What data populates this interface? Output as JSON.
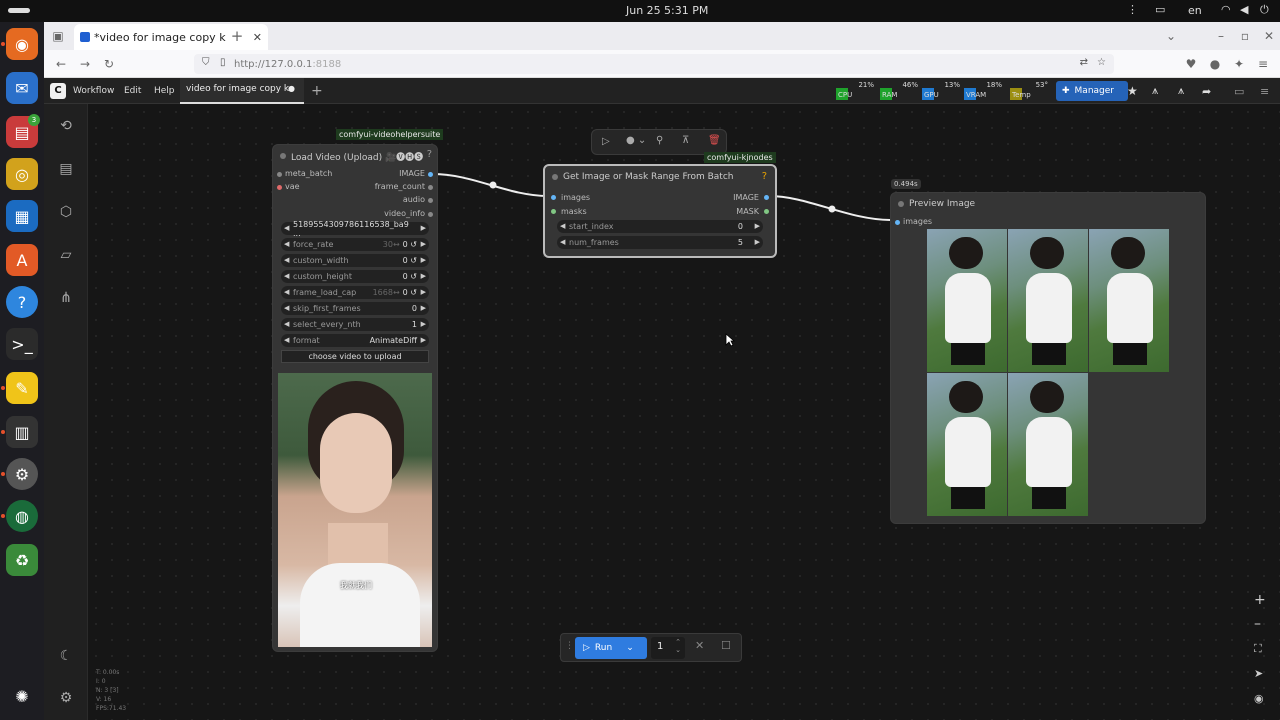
{
  "os": {
    "date": "Jun 25",
    "time": "5:31 PM",
    "lang": "en",
    "badge_count": "3"
  },
  "browser": {
    "tab_title": "*video for image copy k",
    "url_host": "http://127.0.0.1",
    "url_port": ":8188"
  },
  "menu": {
    "workflow": "Workflow",
    "edit": "Edit",
    "help": "Help",
    "tab": "video for image copy k",
    "manager": "Manager"
  },
  "stats": [
    {
      "name": "CPU",
      "pct": "21%",
      "color": "#1fa32c"
    },
    {
      "name": "RAM",
      "pct": "46%",
      "color": "#1fa32c"
    },
    {
      "name": "GPU",
      "pct": "13%",
      "color": "#1f7ad1"
    },
    {
      "name": "VRAM",
      "pct": "18%",
      "color": "#1f7ad1"
    },
    {
      "name": "Temp",
      "pct": "53°",
      "color": "#9c8f12"
    }
  ],
  "nodes": {
    "load_video": {
      "package": "comfyui-videohelpersuite",
      "title": "Load Video (Upload) 🎥🅥🅗🅢",
      "inputs": [
        "meta_batch",
        "vae"
      ],
      "outputs": [
        "IMAGE",
        "frame_count",
        "audio",
        "video_info"
      ],
      "widgets": [
        {
          "label": "5189554309786116538_ba9 ...",
          "value": ""
        },
        {
          "label": "force_rate",
          "hint": "30↔",
          "value": "0 ↺"
        },
        {
          "label": "custom_width",
          "value": "0 ↺"
        },
        {
          "label": "custom_height",
          "value": "0 ↺"
        },
        {
          "label": "frame_load_cap",
          "hint": "1668↔",
          "value": "0 ↺"
        },
        {
          "label": "skip_first_frames",
          "value": "0"
        },
        {
          "label": "select_every_nth",
          "value": "1"
        },
        {
          "label": "format",
          "value": "AnimateDiff"
        }
      ],
      "upload_button": "choose video to upload",
      "subtitle": "我就我们"
    },
    "range": {
      "package": "comfyui-kjnodes",
      "title": "Get Image or Mask Range From Batch",
      "inputs": [
        "images",
        "masks"
      ],
      "outputs": [
        "IMAGE",
        "MASK"
      ],
      "widgets": [
        {
          "label": "start_index",
          "value": "0"
        },
        {
          "label": "num_frames",
          "value": "5"
        }
      ]
    },
    "preview": {
      "time": "0.494s",
      "title": "Preview Image",
      "input": "images"
    }
  },
  "run": {
    "label": "Run",
    "count": "1"
  },
  "debug": [
    "T: 0.00s",
    "I: 0",
    "N: 3 [3]",
    "V: 16",
    "FPS:71.43"
  ]
}
